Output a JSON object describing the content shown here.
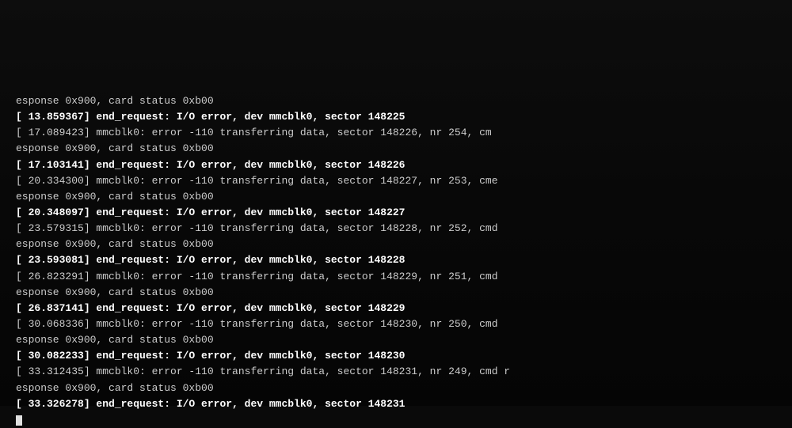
{
  "terminal": {
    "lines": [
      {
        "text": "esponse 0x900, card status 0xb00",
        "bright": false
      },
      {
        "text": "[   13.859367] end_request: I/O error, dev mmcblk0, sector 148225",
        "bright": true
      },
      {
        "text": "[   17.089423] mmcblk0: error -110 transferring data, sector 148226, nr 254, cm",
        "bright": false
      },
      {
        "text": "esponse 0x900, card status 0xb00",
        "bright": false
      },
      {
        "text": "[   17.103141] end_request: I/O error, dev mmcblk0, sector 148226",
        "bright": true
      },
      {
        "text": "[   20.334300] mmcblk0: error -110 transferring data, sector 148227, nr 253, cme",
        "bright": false
      },
      {
        "text": "esponse 0x900, card status 0xb00",
        "bright": false
      },
      {
        "text": "[   20.348097] end_request: I/O error, dev mmcblk0, sector 148227",
        "bright": true
      },
      {
        "text": "[   23.579315] mmcblk0: error -110 transferring data, sector 148228, nr 252, cmd",
        "bright": false
      },
      {
        "text": "esponse 0x900, card status 0xb00",
        "bright": false
      },
      {
        "text": "[   23.593081] end_request: I/O error, dev mmcblk0, sector 148228",
        "bright": true
      },
      {
        "text": "[   26.823291] mmcblk0: error -110 transferring data, sector 148229, nr 251, cmd",
        "bright": false
      },
      {
        "text": "esponse 0x900, card status 0xb00",
        "bright": false
      },
      {
        "text": "[   26.837141] end_request: I/O error, dev mmcblk0, sector 148229",
        "bright": true
      },
      {
        "text": "[   30.068336] mmcblk0: error -110 transferring data, sector 148230, nr 250, cmd",
        "bright": false
      },
      {
        "text": "esponse 0x900, card status 0xb00",
        "bright": false
      },
      {
        "text": "[   30.082233] end_request: I/O error, dev mmcblk0, sector 148230",
        "bright": true
      },
      {
        "text": "[   33.312435] mmcblk0: error -110 transferring data, sector 148231, nr 249, cmd r",
        "bright": false
      },
      {
        "text": "esponse 0x900, card status 0xb00",
        "bright": false
      },
      {
        "text": "[   33.326278] end_request: I/O error, dev mmcblk0, sector 148231",
        "bright": true
      }
    ],
    "cursor_line": "_"
  }
}
